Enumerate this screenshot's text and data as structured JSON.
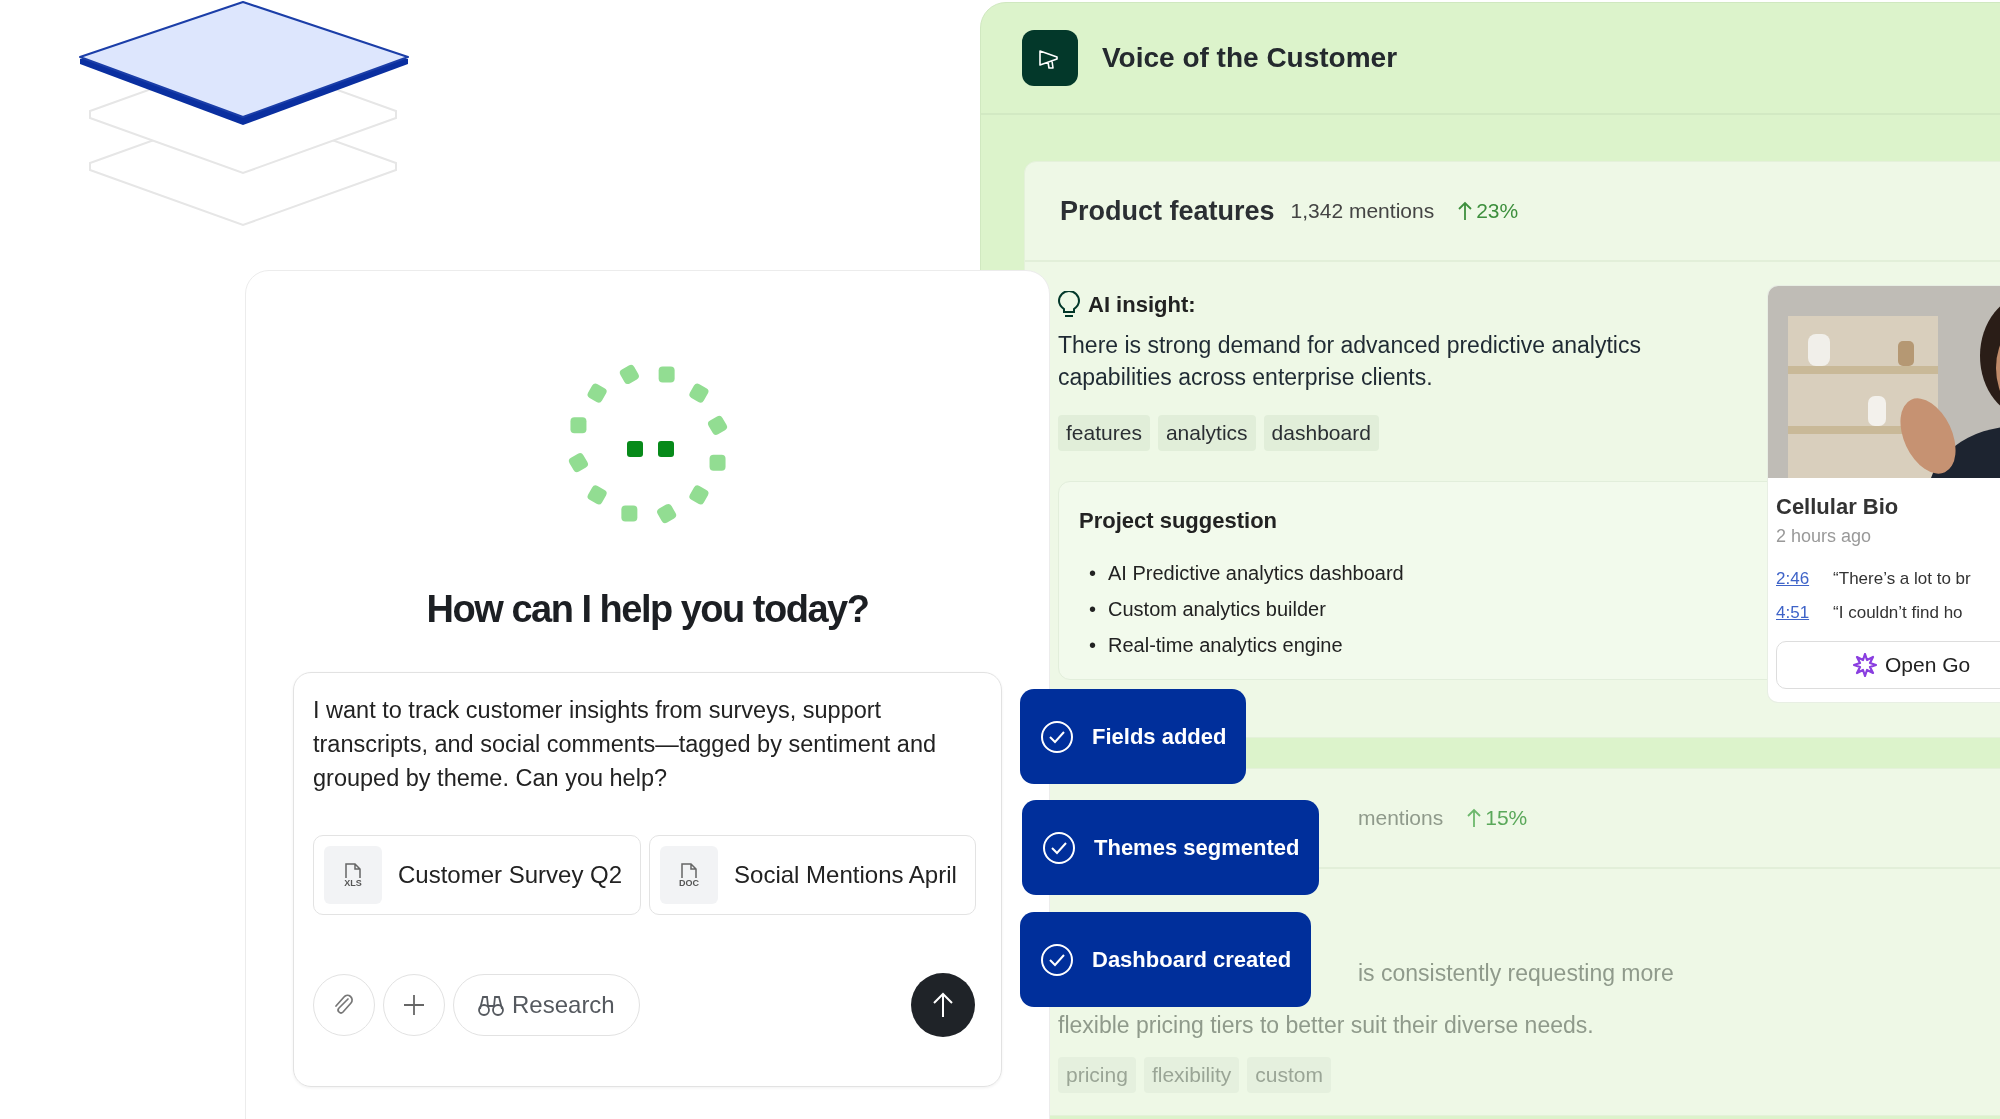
{
  "chat": {
    "heading": "How can I help you today?",
    "prompt": "I want to track customer insights from surveys, support transcripts, and social comments—tagged by sentiment and grouped by theme. Can you help?",
    "attachments": [
      {
        "badge": "XLS",
        "name": "Customer Survey Q2"
      },
      {
        "badge": "DOC",
        "name": "Social Mentions April"
      }
    ],
    "tool_button": "Research"
  },
  "panel": {
    "title": "Voice of the Customer",
    "cards": [
      {
        "dimmed": false,
        "title": "Product features",
        "mentions": "1,342 mentions",
        "trend": "23%",
        "insight_label": "AI insight:",
        "insight_lines": [
          "There is strong demand for advanced predictive analytics capabilities across enterprise clients."
        ],
        "tags": [
          "features",
          "analytics",
          "dashboard"
        ],
        "suggestion": {
          "title": "Project suggestion",
          "marker": "•",
          "items": [
            "AI Predictive analytics dashboard",
            "Custom analytics builder",
            "Real-time analytics engine"
          ]
        },
        "source": {
          "name": "Cellular Bio",
          "time": "2 hours ago",
          "clips": [
            {
              "time": "2:46",
              "quote": "“There’s a lot to br"
            },
            {
              "time": "4:51",
              "quote": "“I couldn’t find ho"
            }
          ],
          "button": "Open Go"
        }
      },
      {
        "dimmed": true,
        "mentions": "mentions",
        "trend": "15%",
        "insight_lines": [
          "is consistently requesting more",
          "flexible pricing tiers to better suit their diverse needs."
        ],
        "tags": [
          "pricing",
          "flexibility",
          "custom"
        ]
      }
    ]
  },
  "toasts": [
    {
      "label": "Fields added"
    },
    {
      "label": "Themes segmented"
    },
    {
      "label": "Dashboard created"
    }
  ]
}
